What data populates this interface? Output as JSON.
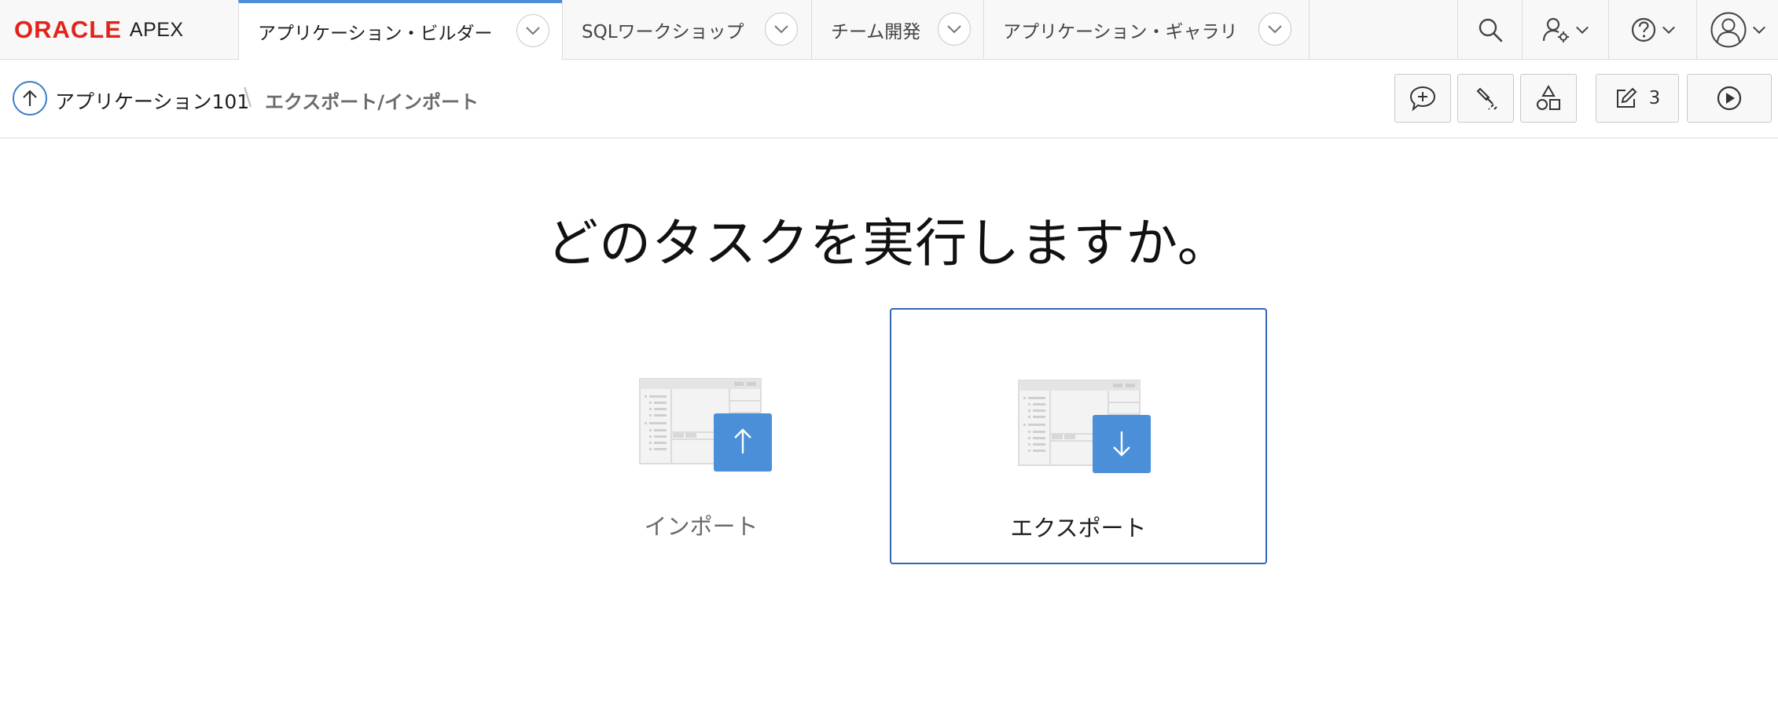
{
  "brand": {
    "oracle": "ORACLE",
    "apex": "APEX",
    "color": "#e2231a"
  },
  "nav": {
    "tabs": [
      {
        "label": "アプリケーション・ビルダー",
        "active": true
      },
      {
        "label": "SQLワークショップ",
        "active": false
      },
      {
        "label": "チーム開発",
        "active": false
      },
      {
        "label": "アプリケーション・ギャラリ",
        "active": false
      }
    ],
    "icons": [
      "search-icon",
      "administration-icon",
      "help-icon",
      "user-icon"
    ]
  },
  "breadcrumb": {
    "app": "アプリケーション101",
    "separator": "\\",
    "current": "エクスポート/インポート"
  },
  "toolbar": {
    "buttons": [
      "feedback-icon",
      "developer-tools-icon",
      "shared-components-icon",
      "edit-page-icon",
      "run-icon"
    ],
    "edit_count": "3"
  },
  "main": {
    "heading": "どのタスクを実行しますか。",
    "options": [
      {
        "label": "インポート",
        "icon": "upload-arrow-icon",
        "selected": false
      },
      {
        "label": "エクスポート",
        "icon": "download-arrow-icon",
        "selected": true
      }
    ],
    "accent": "#4a8fd8",
    "selected_border": "#3566b4"
  }
}
